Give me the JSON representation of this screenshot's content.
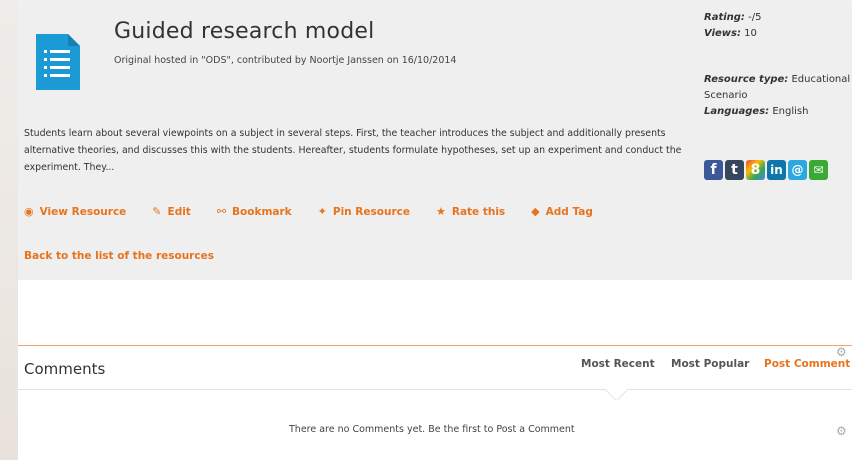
{
  "resource": {
    "title": "Guided research model",
    "subtitle": "Original hosted in \"ODS\", contributed by Noortje Janssen on 16/10/2014",
    "description": "Students learn about several viewpoints on a subject in several steps. First, the teacher introduces the subject and additionally presents alternative theories, and discusses this with the students. Hereafter, students formulate hypotheses, set up an experiment and conduct the experiment. They...",
    "icon": "document-icon",
    "accent_color": "#1b9ad6"
  },
  "meta": {
    "rating_label": "Rating:",
    "rating_value": "-/5",
    "views_label": "Views:",
    "views_value": "10",
    "type_label": "Resource type:",
    "type_value": "Educational Scenario",
    "languages_label": "Languages:",
    "languages_value": "English"
  },
  "social": [
    {
      "name": "facebook",
      "glyph": "f",
      "color": "#3b5998"
    },
    {
      "name": "tumblr",
      "glyph": "t",
      "color": "#36465d"
    },
    {
      "name": "google-plus",
      "glyph": "8",
      "color": "#4285f4"
    },
    {
      "name": "linkedin",
      "glyph": "in",
      "color": "#0e76a8"
    },
    {
      "name": "email-at",
      "glyph": "@",
      "color": "#2ba8e0"
    },
    {
      "name": "email",
      "glyph": "✉",
      "color": "#3aaa35"
    }
  ],
  "actions": {
    "view": "View Resource",
    "edit": "Edit",
    "bookmark": "Bookmark",
    "pin": "Pin Resource",
    "rate": "Rate this",
    "tag": "Add Tag"
  },
  "back_link": "Back to the list of the resources",
  "comments": {
    "title": "Comments",
    "sort_recent": "Most Recent",
    "sort_popular": "Most Popular",
    "post": "Post Comment",
    "empty": "There are no Comments yet. Be the first to Post a Comment"
  },
  "colors": {
    "link_orange": "#e8731d",
    "panel_bg": "#efefef"
  }
}
